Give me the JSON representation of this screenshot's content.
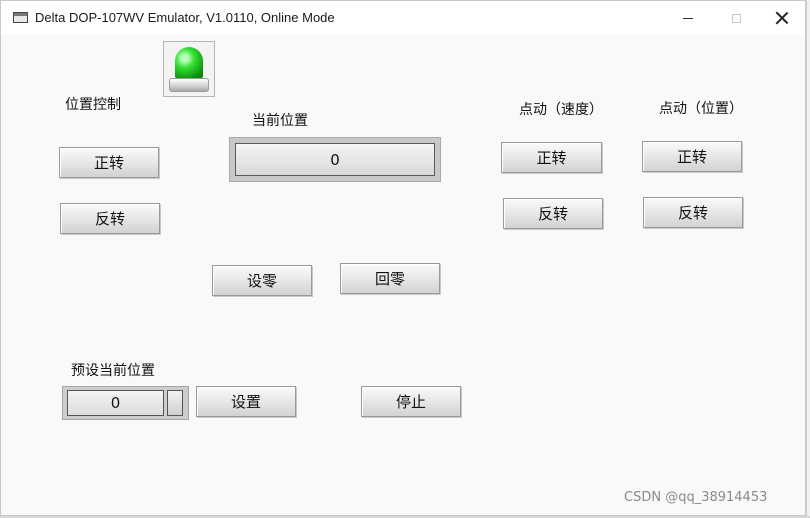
{
  "window": {
    "title": "Delta DOP-107WV Emulator, V1.0110, Online Mode"
  },
  "labels": {
    "position_control": "位置控制",
    "current_position": "当前位置",
    "jog_speed": "点动（速度）",
    "jog_position": "点动（位置）",
    "preset_current_position": "预设当前位置"
  },
  "display": {
    "current_position_value": "0",
    "preset_value": "0"
  },
  "buttons": {
    "pos_forward": "正转",
    "pos_reverse": "反转",
    "jog_speed_forward": "正转",
    "jog_speed_reverse": "反转",
    "jog_pos_forward": "正转",
    "jog_pos_reverse": "反转",
    "set_zero": "设零",
    "return_zero": "回零",
    "set": "设置",
    "stop": "停止"
  },
  "indicator": {
    "icon": "green-signal-lamp-icon",
    "color": "#22cc22"
  },
  "watermark": "CSDN @qq_38914453"
}
